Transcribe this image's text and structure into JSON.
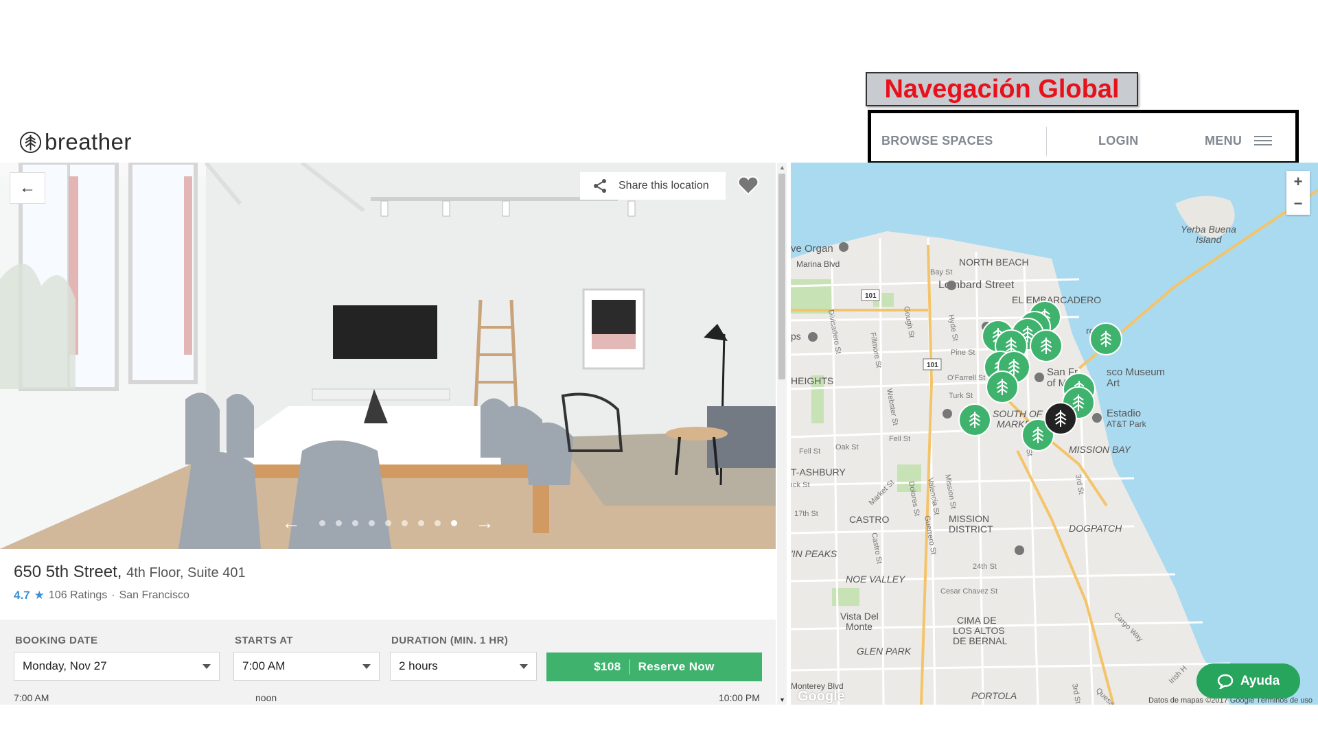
{
  "annotation": {
    "label": "Navegación Global"
  },
  "header": {
    "logo": "breather",
    "nav": {
      "browse": "BROWSE SPACES",
      "login": "LOGIN",
      "menu": "MENU"
    }
  },
  "gallery": {
    "share": "Share this location",
    "dots_total": 9,
    "active_dot": 8
  },
  "listing": {
    "address_main": "650 5th Street,",
    "address_sub": "4th Floor, Suite 401",
    "rating": "4.7",
    "ratings_count": "106 Ratings",
    "separator": "·",
    "city": "San Francisco"
  },
  "booking": {
    "date_label": "BOOKING DATE",
    "date_value": "Monday, Nov 27",
    "start_label": "STARTS AT",
    "start_value": "7:00 AM",
    "duration_label": "DURATION (MIN. 1 HR)",
    "duration_value": "2 hours",
    "price": "$108",
    "reserve": "Reserve Now",
    "timeline": {
      "start": "7:00 AM",
      "mid": "noon",
      "end": "10:00 PM"
    }
  },
  "map": {
    "labels": {
      "north_beach": "NORTH BEACH",
      "lombard": "Lombard Street",
      "embarcadero": "EL EMBARCADERO",
      "yerba1": "Yerba Buena",
      "yerba2": "Island",
      "organ": "ve Organ",
      "marina": "Marina Blvd",
      "heights": "HEIGHTS",
      "south1": "SOUTH OF",
      "south2": "MARKET",
      "mission_bay": "MISSION BAY",
      "estadio1": "Estadio",
      "estadio2": "AT&T Park",
      "museum1": "San Fr",
      "museum2": "sco Museum",
      "museum3": "of M",
      "museum4": "Art",
      "ashbury": "T-ASHBURY",
      "castro": "CASTRO",
      "mission1": "MISSION",
      "mission2": "DISTRICT",
      "dogpatch": "DOGPATCH",
      "peaks": "'IN PEAKS",
      "noe": "NOE VALLEY",
      "vista1": "Vista Del",
      "vista2": "Monte",
      "cima1": "CIMA DE",
      "cima2": "LOS ALTOS",
      "cima3": "DE BERNAL",
      "glen": "GLEN PARK",
      "portola": "PORTOLA",
      "monterey": "Monterey Blvd",
      "ps": "ps",
      "ro": "ro",
      "bay_st": "Bay St",
      "divisadero": "Divisadero St",
      "fillmore": "Fillmore St",
      "gough": "Gough St",
      "hyde": "Hyde St",
      "pine": "Pine St",
      "ofarrell": "O'Farrell St",
      "turk": "Turk St",
      "webster": "Webster St",
      "fell": "Fell St",
      "fell2": "Fell St",
      "oak": "Oak St",
      "lck": "ıck St",
      "st17": "17th St",
      "market": "Market St",
      "dolores": "Dolores St",
      "valencia": "Valencia St",
      "mission_st": "Mission St",
      "guerrero": "Guerrero St",
      "castro_st": "Castro St",
      "st24": "24th St",
      "cesar": "Cesar Chavez St",
      "cargo": "Cargo Way",
      "third": "3rd St",
      "seventh": "7th St",
      "third2": "3rd St",
      "irish": "Irish H",
      "quesad": "Quesad",
      "hw101a": "101",
      "hw101b": "101"
    },
    "credit": "Datos de mapas ©2017 Google    Términos de uso",
    "google": "Google",
    "zoom_in": "+",
    "zoom_out": "−"
  },
  "chat": {
    "label": "Ayuda"
  },
  "colors": {
    "accent": "#3fb36e",
    "rating": "#3d8fd8",
    "water": "#aadaf0",
    "annotation_text": "#e8101b"
  }
}
